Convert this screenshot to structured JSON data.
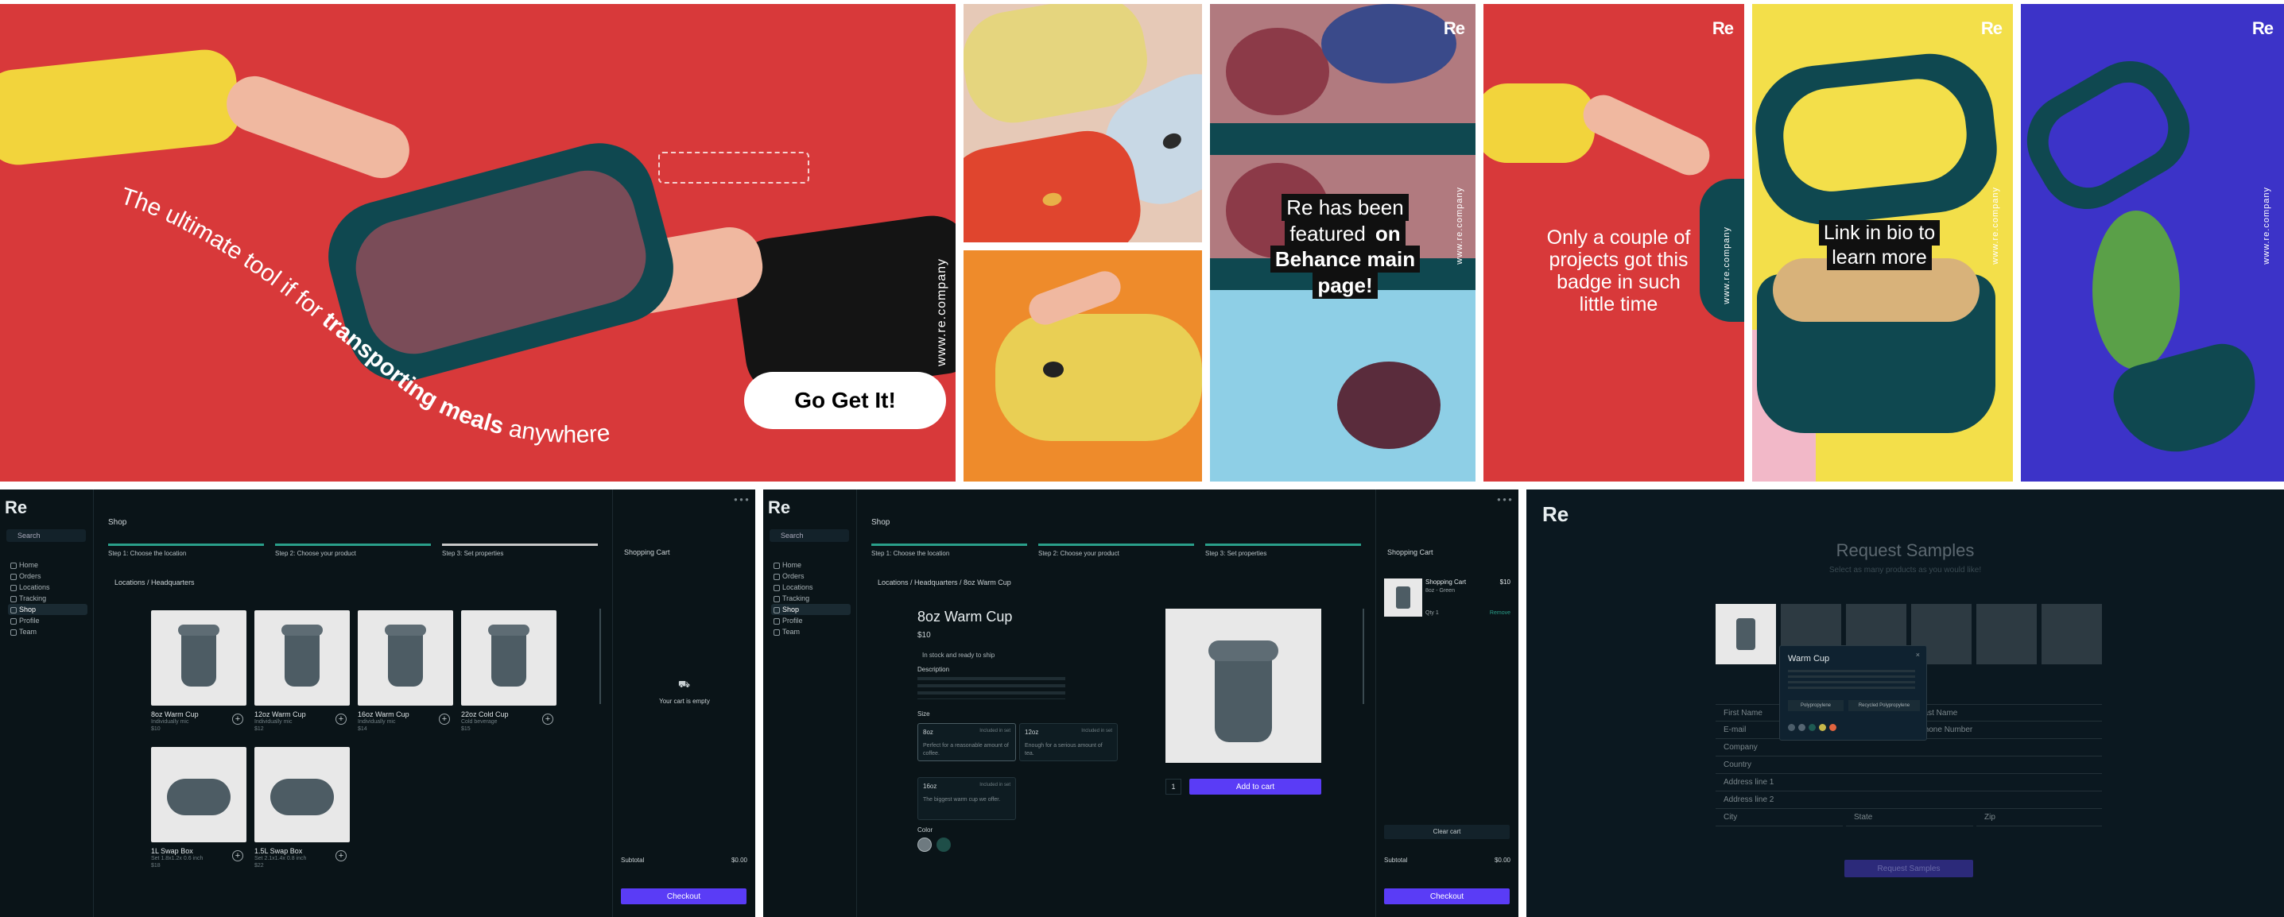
{
  "hero": {
    "curved_text_prefix": "The ultimate tool if for ",
    "curved_text_bold": "transporting meals",
    "curved_text_suffix": " anywhere.",
    "cta_label": "Go Get It!",
    "website": "www.re.company"
  },
  "brand": {
    "logo": "Re",
    "website": "www.re.company"
  },
  "tiles": {
    "featured_banner_lines": [
      "Re has been",
      "featured",
      "on",
      "Behance main",
      "page!"
    ],
    "badge_text_lines": [
      "Only a couple of",
      "projects got this",
      "badge in such",
      "little time"
    ],
    "link_bio_lines": [
      "Link in bio to",
      "learn more"
    ]
  },
  "colors": {
    "hero_red": "#d8393a",
    "teal_bowl": "#0f4850",
    "yellow": "#f3df4a",
    "blue": "#3c33c8",
    "orange": "#ee8b2b",
    "sky": "#8ecfe6",
    "app_bg": "#0a1418",
    "accent_purple": "#5a3cf6",
    "step_green": "#2a9f8a"
  },
  "app": {
    "logo": "Re",
    "search_placeholder": "Search",
    "nav": [
      "Home",
      "Orders",
      "Locations",
      "Tracking",
      "Shop",
      "Profile",
      "Team"
    ],
    "nav_active": "Shop",
    "page_title": "Shop",
    "steps": [
      "Step 1: Choose the location",
      "Step 2: Choose your product",
      "Step 3: Set properties"
    ],
    "cart_title": "Shopping Cart",
    "subtotal_label": "Subtotal",
    "subtotal_value": "$0.00",
    "checkout_label": "Checkout"
  },
  "screen1": {
    "breadcrumb": "Locations / Headquarters",
    "cart_empty": "Your cart is empty",
    "products": [
      {
        "name": "8oz Warm Cup",
        "meta1": "Individually mic",
        "meta2": "$10",
        "shape": "cup"
      },
      {
        "name": "12oz Warm Cup",
        "meta1": "Individually mic",
        "meta2": "$12",
        "shape": "cup"
      },
      {
        "name": "16oz Warm Cup",
        "meta1": "Individually mic",
        "meta2": "$14",
        "shape": "cup"
      },
      {
        "name": "22oz Cold Cup",
        "meta1": "Cold beverage",
        "meta2": "$15",
        "shape": "cup"
      },
      {
        "name": "1L Swap Box",
        "meta1": "Set 1.8x1.2x 0.6 inch",
        "meta2": "$18",
        "shape": "box"
      },
      {
        "name": "1.5L Swap Box",
        "meta1": "Set 2.1x1.4x 0.8 inch",
        "meta2": "$22",
        "shape": "box"
      }
    ]
  },
  "screen2": {
    "breadcrumb": "Locations / Headquarters / 8oz Warm Cup",
    "product_title": "8oz Warm Cup",
    "price": "$10",
    "stock": "In stock and ready to ship",
    "description_label": "Description",
    "size_label": "Size",
    "sizes": [
      {
        "name": "8oz",
        "price": "Included in set",
        "desc": "Perfect for a reasonable amount of coffee."
      },
      {
        "name": "12oz",
        "price": "Included in set",
        "desc": "Enough for a serious amount of tea."
      },
      {
        "name": "16oz",
        "price": "Included in set",
        "desc": "The biggest warm cup we offer."
      }
    ],
    "color_label": "Color",
    "quantity": "1",
    "add_to_cart": "Add to cart",
    "cart_item_name": "Shopping Cart",
    "cart_item_sub": "8oz - Green",
    "cart_item_price": "$10",
    "cart_item_qty": "Qty 1",
    "cart_item_remove": "Remove",
    "clear_cart": "Clear cart"
  },
  "screen3": {
    "title": "Request Samples",
    "subtitle": "Select as many products as you would like!",
    "popup_title": "Warm Cup",
    "popup_option_a": "Polypropylene",
    "popup_option_b": "Recycled Polypropylene",
    "fields": [
      "First Name",
      "Last Name",
      "E-mail",
      "Phone Number",
      "Company",
      "Country",
      "Address line 1",
      "Address line 2",
      "City",
      "State",
      "Zip"
    ],
    "submit": "Request Samples"
  }
}
